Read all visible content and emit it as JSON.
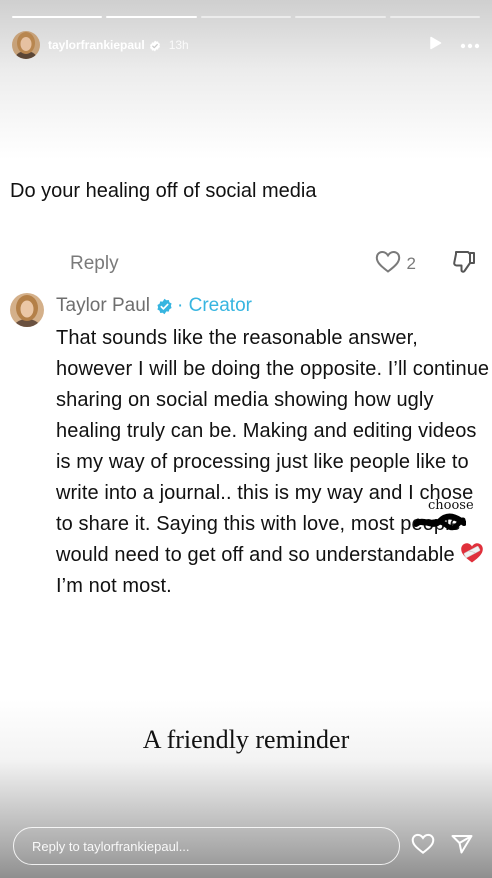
{
  "story": {
    "progress": [
      1,
      1,
      0,
      0,
      0
    ],
    "author": {
      "username": "taylorfrankiepaul",
      "time_ago": "13h",
      "avatar_icon": "profile-photo",
      "verified_icon": "verified-badge-icon"
    },
    "header_icons": [
      "play-icon",
      "more-icon"
    ]
  },
  "comment": {
    "text": "Do your healing off of social media",
    "reply_label": "Reply",
    "like_count": "2",
    "like_icon": "heart-outline-icon",
    "dislike_icon": "thumbs-down-icon"
  },
  "reply": {
    "name": "Taylor Paul",
    "creator_label": "· Creator",
    "verified_color": "#3897f0",
    "creator_color": "#37b5e0",
    "text_before_scribble": "That sounds like the reasonable answer, however I will be doing the opposite. I’ll continue sharing on social media showing how ugly healing truly can be. Making and editing videos is my way of processing just like people like to write into a journal.. this is my way and I ",
    "scribbled_word": "chose",
    "text_after_scribble": " to share it. Saying this with love, most people would need to get off and so understandable ",
    "emoji": "mending-heart-emoji",
    "text_end": " I’m not most.",
    "handwritten_correction": "choose"
  },
  "caption": "A friendly reminder",
  "bottom_bar": {
    "reply_placeholder": "Reply to taylorfrankiepaul...",
    "icons": [
      "heart-outline-icon",
      "send-icon"
    ]
  }
}
